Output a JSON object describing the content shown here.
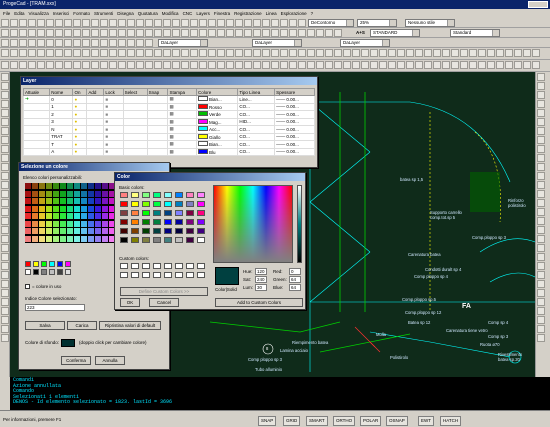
{
  "app": {
    "title": "ProgeCad - [TRAM.sxx]",
    "menu": [
      "File",
      "Edita",
      "Visualizza",
      "Inserisci",
      "Formato",
      "Strumenti",
      "Disegna",
      "Quotatura",
      "Modifica",
      "CNC",
      "Layers",
      "Finestra",
      "Registrazione",
      "Linea",
      "Esplorazione",
      "?"
    ]
  },
  "toolbar": {
    "layer_combo": "DaLayer",
    "layer_combo2": "DaLayer",
    "layer_combo3": "DaLayer",
    "zoom_combo": "DeContorno",
    "percent_combo": "25%",
    "style_combo": "Nessuno stile",
    "text_style_label": "A+S",
    "text_style": "STANDARD",
    "dim_style": "Standard"
  },
  "layer_dialog": {
    "title": "Layer",
    "columns": [
      "Attuale",
      "Nome",
      "On",
      "Add",
      "Lock",
      "Select",
      "Snap",
      "Stampa",
      "Colore",
      "Tipo Linea",
      "Spessore"
    ],
    "rows": [
      {
        "name": "0",
        "color_name": "Bian...",
        "linetype": "Line...",
        "weight": "—— 0.00..."
      },
      {
        "name": "1",
        "color_name": "Rosso",
        "linetype": "CO...",
        "weight": "—— 0.00..."
      },
      {
        "name": "2",
        "color_name": "Verde",
        "linetype": "CO...",
        "weight": "—— 0.00..."
      },
      {
        "name": "3",
        "color_name": "Mag...",
        "linetype": "HID...",
        "weight": "—— 0.00..."
      },
      {
        "name": "N",
        "color_name": "Acc...",
        "linetype": "CO...",
        "weight": "—— 0.00..."
      },
      {
        "name": "TRAT",
        "color_name": "Giallo",
        "linetype": "CO...",
        "weight": "—— 0.00..."
      },
      {
        "name": "T",
        "color_name": "Bian...",
        "linetype": "CO...",
        "weight": "—— 0.00..."
      },
      {
        "name": "A",
        "color_name": "Blu",
        "linetype": "CO...",
        "weight": "—— 0.00..."
      }
    ],
    "row_colors": [
      "#ffffff",
      "#ff0000",
      "#00c000",
      "#ff00ff",
      "#00ffff",
      "#ffff00",
      "#ffffff",
      "#0000ff"
    ]
  },
  "color_select": {
    "title": "Selezione un colore",
    "custom_label": "Elenco colori personalizzabili:",
    "checkbox_label": "= colore in uso",
    "index_label": "Indice Colore selezionato:",
    "index_value": "223",
    "buttons": [
      "Salva",
      "Carica",
      "Ripristina valori di default"
    ],
    "outline_label": "Colore di sfondo:",
    "outline_hint": "(doppio click per cambiare colore)",
    "ok": "Conferma",
    "cancel": "Annulla"
  },
  "color_dialog": {
    "title": "Color",
    "basic_label": "Basic colors:",
    "custom_label": "Custom colors:",
    "define_btn": "Define Custom Colors >>",
    "ok": "OK",
    "cancel": "Cancel",
    "solid_label": "Color|Solid",
    "hue_label": "Hue:",
    "hue": "120",
    "sat_label": "Sat:",
    "sat": "240",
    "lum_label": "Lum:",
    "lum": "30",
    "red_label": "Red:",
    "red": "0",
    "green_label": "Green:",
    "green": "64",
    "blue_label": "Blue:",
    "blue": "64",
    "add_btn": "Add to Custom Colors"
  },
  "cad_labels": {
    "batea": "batea sp 1,5",
    "supporto": "Supporto carrello\ncomp.tot.sp 5",
    "rinforzo": "Rinforzo\npolistirolo",
    "comp3": "Comp.ploppo sp 3",
    "carenatura": "Carenatura batea",
    "condotti": "Condotti duralt sp 4",
    "comp_ploppo2": "Comp ploppo sp 4",
    "comp5": "Comp.ploppo sp.5",
    "comp12": "Comp.ploppo sp 12",
    "fa": "FA",
    "batea12": "Batea sp 12",
    "comp_sp4": "Comp sp 4",
    "carenatura_vetro": "Carenatura tiene vetro",
    "comp_sp3": "Comp sp 3",
    "comp_sp4b": "Comp sp 4",
    "molla": "Molla",
    "riempimento": "Riempimento batea",
    "lamina": "Lamina acciaio",
    "polistirolo": "Polistirolo",
    "circle_num": "8",
    "comp_ploppo_sp3": "Comp ploppo sp 3",
    "tubo": "Tubo alluminio",
    "ruota": "Ruota ø70",
    "rivestimento": "Rivestimento\nbatea sp.20"
  },
  "command_lines": [
    "Comandi",
    "Azione annullata",
    "Comando",
    "Selezionati 1 elementi",
    "DENOS - Id elemento selezionato = 1823. lastId = 3696"
  ],
  "status": {
    "help": "Per informazioni, premere F1",
    "snap": "SNAP",
    "grid": "GRID",
    "smart": "SMART",
    "ortho": "ORTHO",
    "polar": "POLAR",
    "osnap": "OSNAP",
    "ewt": "EWT",
    "hatch": "HATCH"
  },
  "colors": {
    "canvas": "#0f2b1a",
    "cad_cyan": "#00ffff",
    "cad_green": "#00d000",
    "cad_yellow": "#ffff00",
    "title_blue": "#0a246a",
    "selected_swatch": "#004040"
  }
}
